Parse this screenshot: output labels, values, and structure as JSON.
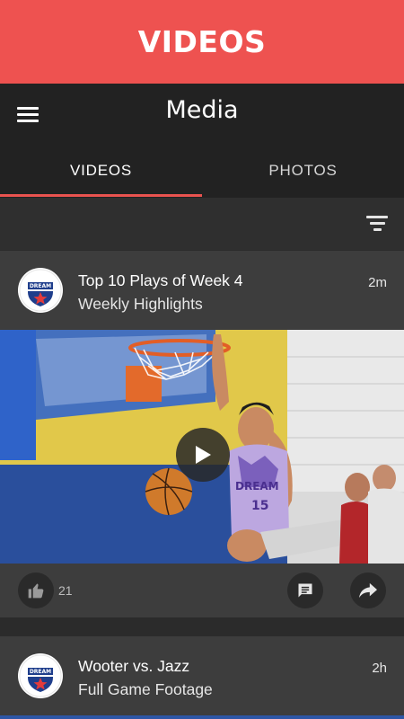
{
  "banner": {
    "title": "VIDEOS",
    "color": "#ee5250"
  },
  "appbar": {
    "title": "Media"
  },
  "tabs": [
    {
      "label": "VIDEOS",
      "active": true
    },
    {
      "label": "PHOTOS",
      "active": false
    }
  ],
  "feed": [
    {
      "title": "Top 10 Plays of Week 4",
      "subtitle": "Weekly Highlights",
      "time": "2m",
      "likes": "21",
      "logo_text": "DREAM"
    },
    {
      "title": "Wooter vs. Jazz",
      "subtitle": "Full Game Footage",
      "time": "2h",
      "logo_text": "DREAM"
    }
  ],
  "colors": {
    "accent": "#e9534f",
    "bar": "#222222",
    "card": "#3d3d3d"
  }
}
